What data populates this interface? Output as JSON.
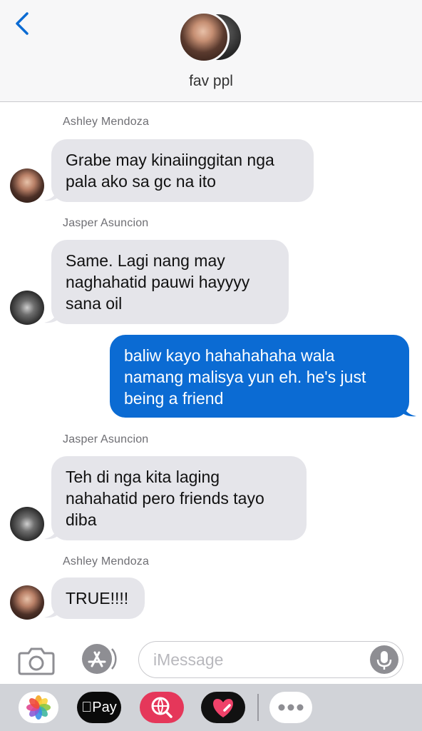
{
  "header": {
    "back_icon": "chevron-left-icon",
    "title": "fav ppl",
    "accent": "#0b6bd3"
  },
  "messages": [
    {
      "sender": "Ashley Mendoza",
      "text_lines": [
        "Grabe may kinaiinggitan nga",
        "pala ako sa gc na ito"
      ],
      "direction": "incoming"
    },
    {
      "sender": "Jasper Asuncion",
      "text_lines": [
        "Same. Lagi nang may",
        "naghahatid pauwi hayyyy",
        "sana oil"
      ],
      "direction": "incoming"
    },
    {
      "sender": "",
      "text_lines": [
        "baliw kayo hahahahaha wala",
        "namang malisya yun eh. he's just",
        "being a friend"
      ],
      "direction": "outgoing"
    },
    {
      "sender": "Jasper Asuncion",
      "text_lines": [
        "Teh di nga kita laging",
        "nahahatid pero friends tayo",
        "diba"
      ],
      "direction": "incoming"
    },
    {
      "sender": "Ashley Mendoza",
      "text_lines": [
        "TRUE!!!!"
      ],
      "direction": "incoming"
    }
  ],
  "composer": {
    "placeholder": "iMessage",
    "camera_icon": "camera-icon",
    "appstore_icon": "app-store-icon",
    "mic_icon": "microphone-icon"
  },
  "app_drawer": {
    "items": [
      {
        "name": "photos",
        "icon": "photos-icon"
      },
      {
        "name": "apple-pay",
        "label": "Pay",
        "icon": "apple-icon"
      },
      {
        "name": "image-search",
        "icon": "search-globe-icon"
      },
      {
        "name": "digital-touch",
        "icon": "heart-icon"
      },
      {
        "name": "more",
        "icon": "more-icon"
      }
    ]
  },
  "colors": {
    "incoming_bubble": "#e5e5ea",
    "outgoing_bubble": "#0b6bd3",
    "drawer_bg": "#d1d3d8"
  }
}
